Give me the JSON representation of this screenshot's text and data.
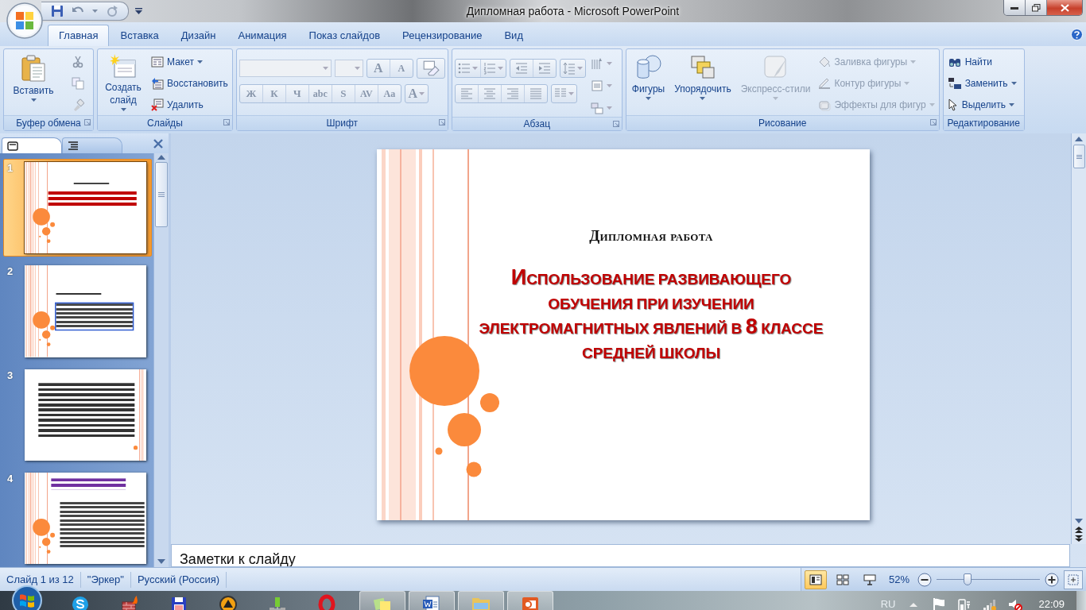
{
  "window": {
    "title": "Дипломная работа - Microsoft PowerPoint"
  },
  "tabs": [
    {
      "label": "Главная",
      "selected": true
    },
    {
      "label": "Вставка",
      "selected": false
    },
    {
      "label": "Дизайн",
      "selected": false
    },
    {
      "label": "Анимация",
      "selected": false
    },
    {
      "label": "Показ слайдов",
      "selected": false
    },
    {
      "label": "Рецензирование",
      "selected": false
    },
    {
      "label": "Вид",
      "selected": false
    }
  ],
  "ribbon_groups": [
    {
      "kind": "clipboard",
      "name": "Буфер обмена",
      "items": [
        {
          "label": "Вставить",
          "disabled": false
        }
      ]
    },
    {
      "kind": "slides",
      "name": "Слайды",
      "items": [
        {
          "label": "Создать слайд",
          "disabled": false
        },
        {
          "label": "Макет",
          "disabled": false
        },
        {
          "label": "Восстановить",
          "disabled": false
        },
        {
          "label": "Удалить",
          "disabled": false
        }
      ]
    },
    {
      "kind": "font",
      "name": "Шрифт",
      "items": [
        {
          "kind": "grow",
          "label": "A",
          "disabled": true
        },
        {
          "kind": "shrink",
          "label": "A",
          "disabled": true
        },
        {
          "kind": "format",
          "label": "Ж",
          "disabled": true
        },
        {
          "kind": "format",
          "label": "К",
          "disabled": true
        },
        {
          "kind": "format",
          "label": "Ч",
          "disabled": true
        },
        {
          "kind": "format",
          "label": "abc",
          "disabled": true
        },
        {
          "kind": "format",
          "label": "S",
          "disabled": true
        },
        {
          "kind": "format",
          "label": "AV",
          "disabled": true
        },
        {
          "kind": "format",
          "label": "Aa",
          "disabled": true
        },
        {
          "kind": "color",
          "label": "A",
          "disabled": true
        }
      ]
    },
    {
      "kind": "paragraph",
      "name": "Абзац"
    },
    {
      "kind": "drawing",
      "name": "Рисование",
      "items": [
        {
          "label": "Фигуры",
          "disabled": false
        },
        {
          "label": "Упорядочить",
          "disabled": false
        },
        {
          "label": "Экспресс-стили",
          "disabled": true
        },
        {
          "label": "Заливка фигуры",
          "disabled": true
        },
        {
          "label": "Контур фигуры",
          "disabled": true
        },
        {
          "label": "Эффекты для фигур",
          "disabled": true
        }
      ]
    },
    {
      "kind": "editing",
      "name": "Редактирование",
      "items": [
        {
          "label": "Найти",
          "disabled": false
        },
        {
          "label": "Заменить",
          "disabled": false
        },
        {
          "label": "Выделить",
          "disabled": false
        }
      ]
    }
  ],
  "panel_tabs": [
    {
      "selected": true
    },
    {
      "selected": false
    }
  ],
  "slides": [
    {
      "number": "1",
      "selected": true,
      "kind": "title"
    },
    {
      "number": "2",
      "selected": false,
      "kind": "box"
    },
    {
      "number": "3",
      "selected": false,
      "kind": "text"
    },
    {
      "number": "4",
      "selected": false,
      "kind": "quote"
    }
  ],
  "current_slide": {
    "heading": "Дипломная работа",
    "title": "Использование развивающего обучения при изучении электромагнитных явлений в 8 классе средней школы"
  },
  "notes": {
    "placeholder": "Заметки к слайду"
  },
  "status_bar": {
    "items": [
      "Слайд 1 из 12",
      "\"Эркер\"",
      "Русский (Россия)"
    ],
    "views": [
      {
        "selected": true
      },
      {
        "selected": false
      },
      {
        "selected": false
      }
    ],
    "zoom": "52%",
    "zoom_slider": {
      "level": 0.3
    }
  },
  "taskbar": {
    "apps": [
      {
        "kind": "skype",
        "open": false
      },
      {
        "kind": "firewall",
        "open": false
      },
      {
        "kind": "floppy",
        "open": false
      },
      {
        "kind": "player",
        "open": false
      },
      {
        "kind": "network",
        "open": false
      },
      {
        "kind": "opera",
        "open": false
      },
      {
        "kind": "notes",
        "open": true
      },
      {
        "kind": "word",
        "open": true
      },
      {
        "kind": "folder",
        "open": true
      },
      {
        "kind": "powerpoint",
        "open": true
      }
    ],
    "language": "RU",
    "time": "22:09"
  }
}
